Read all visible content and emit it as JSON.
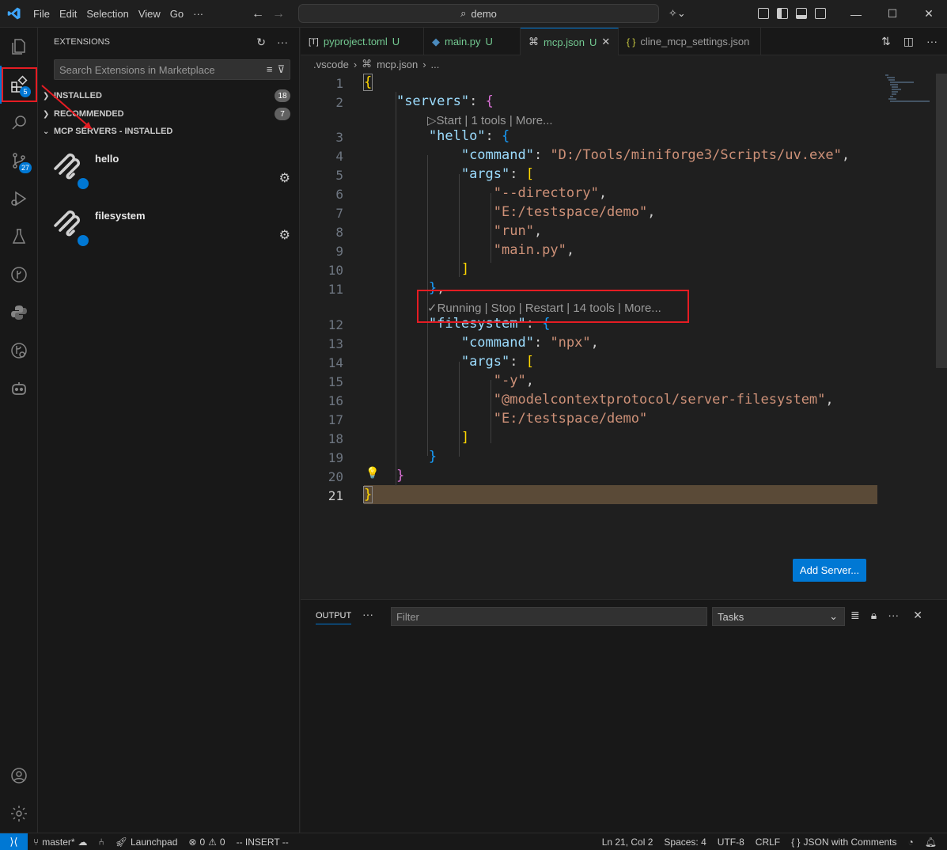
{
  "titlebar": {
    "menu": [
      "File",
      "Edit",
      "Selection",
      "View",
      "Go",
      "···"
    ],
    "search": "demo"
  },
  "activity": {
    "extensions_badge": "5",
    "scm_badge": "27"
  },
  "sidebar": {
    "title": "EXTENSIONS",
    "search_placeholder": "Search Extensions in Marketplace",
    "sections": [
      {
        "label": "INSTALLED",
        "count": "18"
      },
      {
        "label": "RECOMMENDED",
        "count": "7"
      },
      {
        "label": "MCP SERVERS - INSTALLED"
      }
    ],
    "servers": [
      {
        "name": "hello"
      },
      {
        "name": "filesystem"
      }
    ]
  },
  "tabs": [
    {
      "label": "pyproject.toml",
      "icon": "[T]",
      "modified": "U"
    },
    {
      "label": "main.py",
      "modified": "U"
    },
    {
      "label": "mcp.json",
      "modified": "U"
    },
    {
      "label": "cline_mcp_settings.json",
      "icon": "{ }"
    }
  ],
  "breadcrumb": {
    "folder": ".vscode",
    "file": "mcp.json",
    "more": "..."
  },
  "editor": {
    "lens_hello": "Start | 1 tools | More...",
    "lens_filesystem": "Running | Stop | Restart | 14 tools | More...",
    "add_server_label": "Add Server...",
    "line_numbers": [
      "1",
      "2",
      "3",
      "4",
      "5",
      "6",
      "7",
      "8",
      "9",
      "10",
      "11",
      "12",
      "13",
      "14",
      "15",
      "16",
      "17",
      "18",
      "19",
      "20",
      "21"
    ],
    "lines": {
      "l2_key": "\"servers\"",
      "l3_key": "\"hello\"",
      "l4_key": "\"command\"",
      "l4_val": "\"D:/Tools/miniforge3/Scripts/uv.exe\"",
      "l5_key": "\"args\"",
      "l6_val": "\"--directory\"",
      "l7_val": "\"E:/testspace/demo\"",
      "l8_val": "\"run\"",
      "l9_val": "\"main.py\"",
      "l12_key": "\"filesystem\"",
      "l13_key": "\"command\"",
      "l13_val": "\"npx\"",
      "l14_key": "\"args\"",
      "l15_val": "\"-y\"",
      "l16_val": "\"@modelcontextprotocol/server-filesystem\"",
      "l17_val": "\"E:/testspace/demo\""
    }
  },
  "panel": {
    "tab": "OUTPUT",
    "filter_placeholder": "Filter",
    "select_value": "Tasks"
  },
  "statusbar": {
    "branch": "master*",
    "launchpad": "Launchpad",
    "errors": "0",
    "warnings": "0",
    "mode": "-- INSERT --",
    "position": "Ln 21, Col 2",
    "spaces": "Spaces: 4",
    "encoding": "UTF-8",
    "eol": "CRLF",
    "language": "JSON with Comments"
  },
  "colors": {
    "accent": "#0078d4",
    "annotation": "#e51c23"
  }
}
